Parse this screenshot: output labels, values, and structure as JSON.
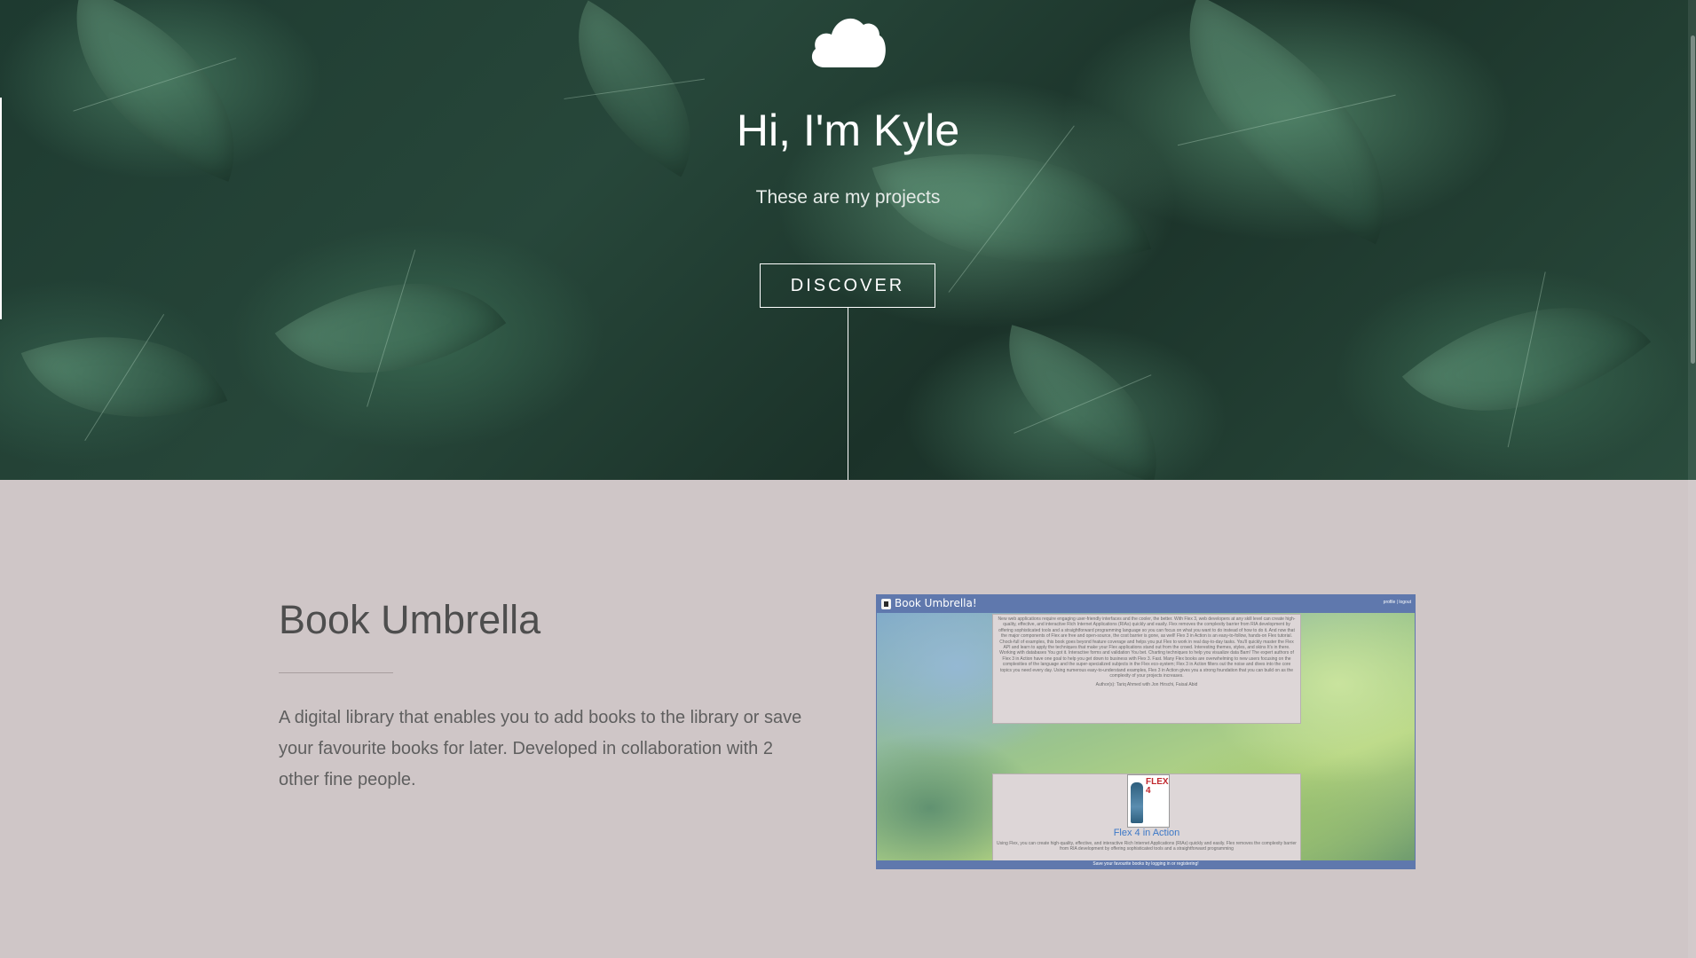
{
  "hero": {
    "icon": "cloud-icon",
    "title": "Hi, I'm Kyle",
    "subtitle": "These are my projects",
    "discover_label": "DISCOVER"
  },
  "project": {
    "title": "Book Umbrella",
    "description": "A digital library that enables you to add books to the library or save your favourite books for later. Developed in collaboration with 2 other fine people.",
    "preview": {
      "brand": "Book Umbrella!",
      "links": "profile | logout",
      "top_blurb": "New web applications require engaging user-friendly interfaces and the cooler, the better. With Flex 3, web developers at any skill level can create high-quality, effective, and interactive Rich Internet Applications (RIAs) quickly and easily. Flex removes the complexity barrier from RIA development by offering sophisticated tools and a straightforward programming language so you can focus on what you want to do instead of how to do it. And now that the major components of Flex are free and open-source, the cost barrier is gone, as well! Flex 3 in Action is an easy-to-follow, hands-on Flex tutorial. Chock-full of examples, this book goes beyond feature coverage and helps you put Flex to work in real day-to-day tasks. You'll quickly master the Flex API and learn to apply the techniques that make your Flex applications stand out from the crowd. Interesting themes, styles, and skins It's in there. Working with databases You got it. Interactive forms and validation You bet. Charting techniques to help you visualize data Bam! The expert authors of Flex 3 in Action have one goal to help you get down to business with Flex 3. Fast. Many Flex books are overwhelming to new users focusing on the complexities of the language and the super-specialized subjects in the Flex eco-system; Flex 3 in Action filters out the noise and dives into the core topics you need every day. Using numerous easy-to-understand examples, Flex 3 in Action gives you a strong foundation that you can build on as the complexity of your projects increases.",
      "author": "Author(s): Tariq Ahmed with Jon Hirschi, Faisal Abid",
      "cover_text": "FLEX 4",
      "book_title": "Flex 4 in Action",
      "book_blurb": "Using Flex, you can create high-quality, effective, and interactive Rich Internet Applications (RIAs) quickly and easily. Flex removes the complexity barrier from RIA development by offering sophisticated tools and a straightforward programming",
      "footer": "Save your favourite books by logging in or registering!"
    }
  }
}
